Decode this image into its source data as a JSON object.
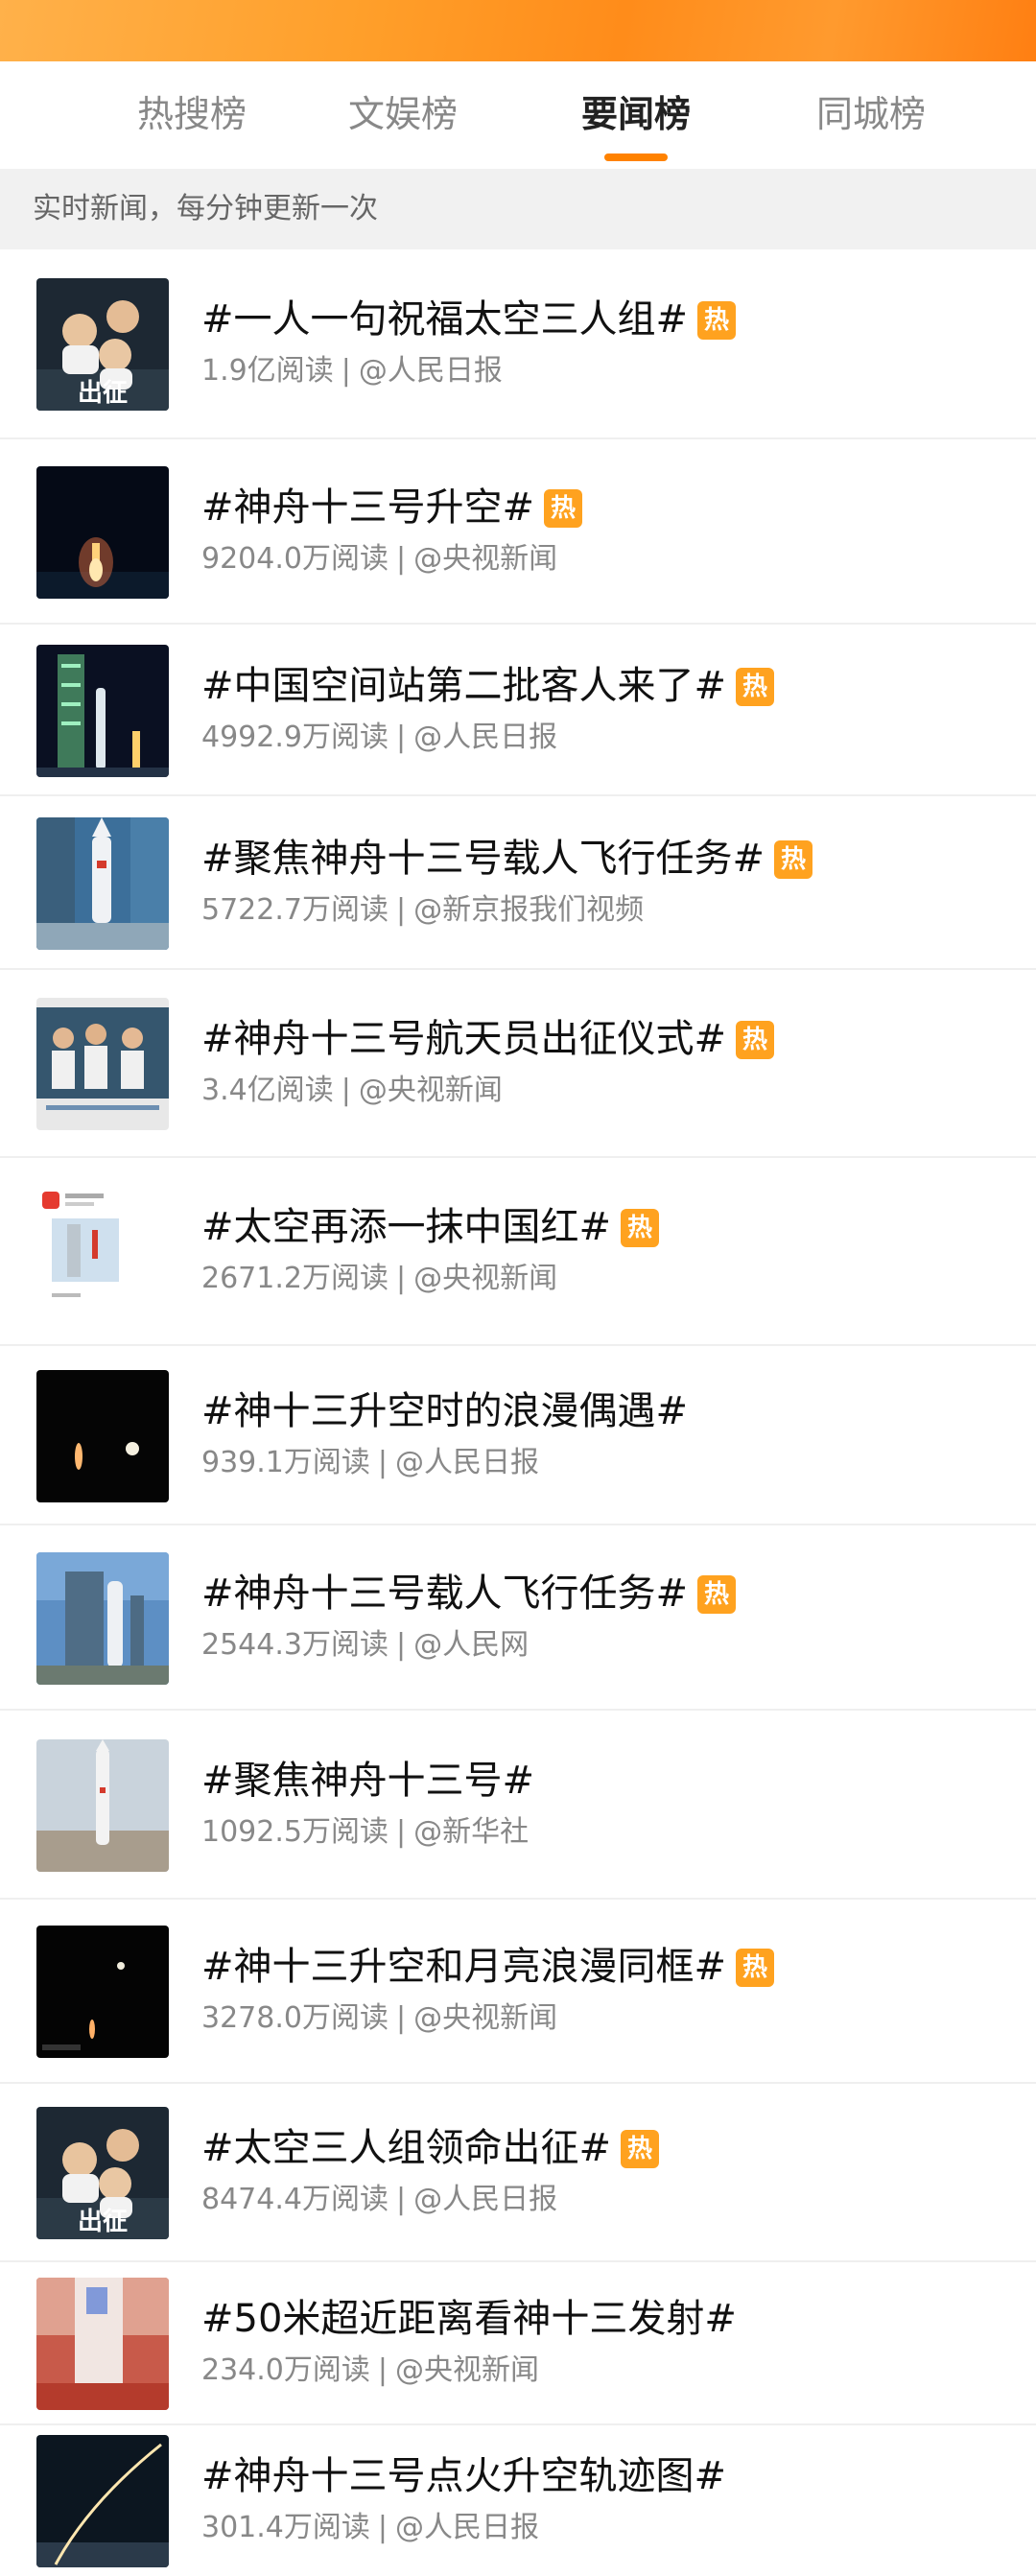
{
  "tabs": [
    {
      "label": "热搜榜",
      "active": false
    },
    {
      "label": "文娱榜",
      "active": false
    },
    {
      "label": "要闻榜",
      "active": true
    },
    {
      "label": "同城榜",
      "active": false
    }
  ],
  "subheader": "实时新闻，每分钟更新一次",
  "hot_badge": "热",
  "items": [
    {
      "title": "#一人一句祝福太空三人组#",
      "hot": true,
      "reads": "1.9亿阅读",
      "source": "@人民日报",
      "thumb": "astronauts"
    },
    {
      "title": "#神舟十三号升空#",
      "hot": true,
      "reads": "9204.0万阅读",
      "source": "@央视新闻",
      "thumb": "launch-night"
    },
    {
      "title": "#中国空间站第二批客人来了#",
      "hot": true,
      "reads": "4992.9万阅读",
      "source": "@人民日报",
      "thumb": "tower-night"
    },
    {
      "title": "#聚焦神舟十三号载人飞行任务#",
      "hot": true,
      "reads": "5722.7万阅读",
      "source": "@新京报我们视频",
      "thumb": "rocket-aerial"
    },
    {
      "title": "#神舟十三号航天员出征仪式#",
      "hot": true,
      "reads": "3.4亿阅读",
      "source": "@央视新闻",
      "thumb": "ceremony"
    },
    {
      "title": "#太空再添一抹中国红#",
      "hot": true,
      "reads": "2671.2万阅读",
      "source": "@央视新闻",
      "thumb": "screenshot"
    },
    {
      "title": "#神十三升空时的浪漫偶遇#",
      "hot": false,
      "reads": "939.1万阅读",
      "source": "@人民日报",
      "thumb": "moon-night"
    },
    {
      "title": "#神舟十三号载人飞行任务#",
      "hot": true,
      "reads": "2544.3万阅读",
      "source": "@人民网",
      "thumb": "tower-day"
    },
    {
      "title": "#聚焦神舟十三号#",
      "hot": false,
      "reads": "1092.5万阅读",
      "source": "@新华社",
      "thumb": "rocket-sky"
    },
    {
      "title": "#神十三升空和月亮浪漫同框#",
      "hot": true,
      "reads": "3278.0万阅读",
      "source": "@央视新闻",
      "thumb": "moon-rocket"
    },
    {
      "title": "#太空三人组领命出征#",
      "hot": true,
      "reads": "8474.4万阅读",
      "source": "@人民日报",
      "thumb": "astronauts"
    },
    {
      "title": "#50米超近距离看神十三发射#",
      "hot": false,
      "reads": "234.0万阅读",
      "source": "@央视新闻",
      "thumb": "rocket-close"
    },
    {
      "title": "#神舟十三号点火升空轨迹图#",
      "hot": false,
      "reads": "301.4万阅读",
      "source": "@人民日报",
      "thumb": "trajectory"
    }
  ],
  "thumb_texts": {
    "astronauts": "出征"
  },
  "colors": {
    "accent": "#ff8200",
    "hot_badge": "#ffa21f",
    "meta_text": "#888888"
  }
}
